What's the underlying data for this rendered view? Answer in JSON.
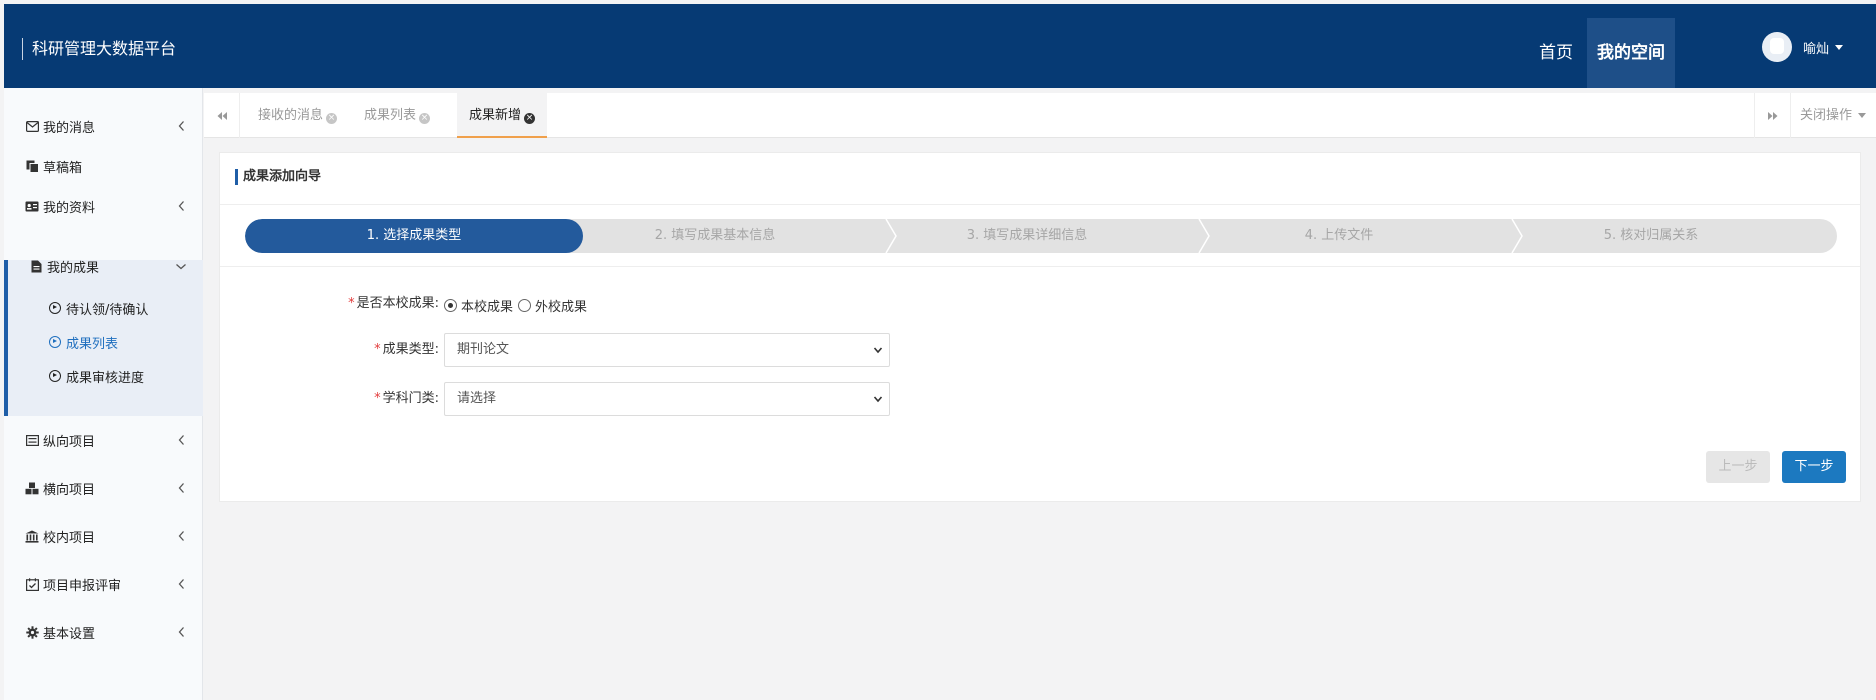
{
  "header": {
    "title": "科研管理大数据平台",
    "nav": [
      "首页",
      "我的空间"
    ],
    "active_nav": "我的空间",
    "user_name": "喻灿"
  },
  "sidebar": {
    "items": [
      {
        "label": "我的消息",
        "icon": "envelope-icon"
      },
      {
        "label": "草稿箱",
        "icon": "copy-icon"
      },
      {
        "label": "我的资料",
        "icon": "id-card-icon"
      },
      {
        "label": "我的成果",
        "icon": "file-icon"
      },
      {
        "label": "纵向项目",
        "icon": "list-icon"
      },
      {
        "label": "横向项目",
        "icon": "cubes-icon"
      },
      {
        "label": "校内项目",
        "icon": "bank-icon"
      },
      {
        "label": "项目申报评审",
        "icon": "calendar-check-icon"
      },
      {
        "label": "基本设置",
        "icon": "gear-icon"
      }
    ],
    "sub_items": [
      {
        "label": "待认领/待确认"
      },
      {
        "label": "成果列表"
      },
      {
        "label": "成果审核进度"
      }
    ],
    "active_sub": "成果列表"
  },
  "tabs": {
    "items": [
      "接收的消息",
      "成果列表",
      "成果新增"
    ],
    "active": "成果新增",
    "close_ops": "关闭操作"
  },
  "wizard": {
    "title": "成果添加向导",
    "steps": [
      "1. 选择成果类型",
      "2. 填写成果基本信息",
      "3. 填写成果详细信息",
      "4. 上传文件",
      "5. 核对归属关系"
    ],
    "active_step": 1
  },
  "form": {
    "school_label": "是否本校成果:",
    "school_options": [
      "本校成果",
      "外校成果"
    ],
    "school_selected": "本校成果",
    "type_label": "成果类型:",
    "type_value": "期刊论文",
    "subject_label": "学科门类:",
    "subject_value": "请选择"
  },
  "buttons": {
    "prev": "上一步",
    "next": "下一步"
  },
  "colors": {
    "header_bg": "#063a74",
    "active_step": "#235a9c",
    "next_button": "#1c79c0",
    "active_link": "#1f6fbf",
    "required": "#e23b3b"
  }
}
